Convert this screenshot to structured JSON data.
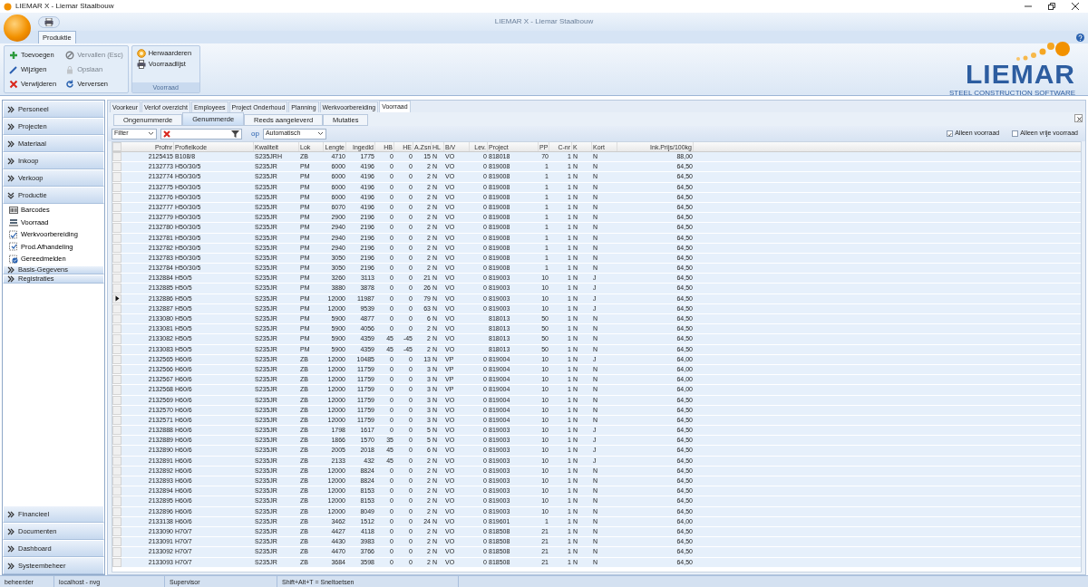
{
  "window": {
    "title": "LIEMAR X - Liemar Staalbouw",
    "caption": "LIEMAR X - Liemar Staalbouw"
  },
  "ribbon": {
    "tabs": [
      {
        "label": "Produktie",
        "selected": true
      }
    ],
    "groups": [
      {
        "buttons": [
          {
            "label": "Toevoegen",
            "disabled": false
          },
          {
            "label": "Wijzigen",
            "disabled": false
          },
          {
            "label": "Verwijderen",
            "disabled": false
          },
          {
            "label": "Vervallen (Esc)",
            "disabled": true
          },
          {
            "label": "Opslaan",
            "disabled": true
          },
          {
            "label": "Verversen",
            "disabled": false
          }
        ]
      },
      {
        "label": "Voorraad",
        "buttons": [
          {
            "label": "Herwaarderen",
            "disabled": false
          },
          {
            "label": "Voorraadlijst",
            "disabled": false
          }
        ]
      }
    ],
    "logo": {
      "name": "LIEMAR",
      "tagline": "STEEL CONSTRUCTION SOFTWARE"
    }
  },
  "sidebar": {
    "top": [
      {
        "label": "Personeel",
        "expanded": false
      },
      {
        "label": "Projecten",
        "expanded": false
      },
      {
        "label": "Materiaal",
        "expanded": false
      },
      {
        "label": "Inkoop",
        "expanded": false
      },
      {
        "label": "Verkoop",
        "expanded": false
      },
      {
        "label": "Productie",
        "expanded": true,
        "children": [
          {
            "label": "Barcodes"
          },
          {
            "label": "Voorraad"
          },
          {
            "label": "Werkvoorbereiding"
          },
          {
            "label": "Prod.Afhandeling"
          },
          {
            "label": "Gereedmelden"
          }
        ]
      }
    ],
    "sub": [
      {
        "label": "Basis-Gegevens"
      },
      {
        "label": "Registraties"
      }
    ],
    "bottom": [
      {
        "label": "Financieel",
        "expanded": false
      },
      {
        "label": "Documenten",
        "expanded": false
      },
      {
        "label": "Dashboard",
        "expanded": false
      },
      {
        "label": "Systeembeheer",
        "expanded": false
      }
    ]
  },
  "tabs": [
    {
      "label": "Voorkeur",
      "selected": false
    },
    {
      "label": "Verlof overzicht",
      "selected": false
    },
    {
      "label": "Employees",
      "selected": false
    },
    {
      "label": "Project Onderhoud",
      "selected": false
    },
    {
      "label": "Planning",
      "selected": false
    },
    {
      "label": "Werkvoorbereiding",
      "selected": false
    },
    {
      "label": "Voorraad",
      "selected": true
    }
  ],
  "subtabs": [
    {
      "label": "Ongenummerde",
      "selected": false
    },
    {
      "label": "Genummerde",
      "selected": true
    },
    {
      "label": "Reeds aangeleverd",
      "selected": false
    },
    {
      "label": "Mutaties",
      "selected": false
    }
  ],
  "filter": {
    "field": "Filter",
    "op_label": "op",
    "mode": "Automatisch",
    "checkboxes": [
      {
        "label": "Alleen voorraad",
        "checked": true
      },
      {
        "label": "Alleen vrije voorraad",
        "checked": false
      }
    ]
  },
  "table": {
    "columns": [
      "Profnr",
      "Profielkode",
      "Kwaliteit",
      "Lok",
      "Lengte",
      "Ingedld",
      "HB",
      "HE",
      "A.Zsn",
      "HL",
      "B/V",
      "Lev.",
      "Project",
      "PP",
      "C-nr",
      "K",
      "Kort",
      "Ink.Prijs/100kg"
    ],
    "rows": [
      {
        "current": false,
        "cells": [
          "2125415",
          "B108/8",
          "S235JRH",
          "ZB",
          "4710",
          "1775",
          "0",
          "0",
          "15",
          "N",
          "VO",
          "0",
          "818018",
          "70",
          "1",
          "N",
          "N",
          "88,00"
        ]
      },
      {
        "current": false,
        "cells": [
          "2132773",
          "H50/30/5",
          "S235JR",
          "PM",
          "6000",
          "4196",
          "0",
          "0",
          "2",
          "N",
          "VO",
          "0",
          "819008",
          "1",
          "1",
          "N",
          "N",
          "64,50"
        ]
      },
      {
        "current": false,
        "cells": [
          "2132774",
          "H50/30/5",
          "S235JR",
          "PM",
          "6000",
          "4196",
          "0",
          "0",
          "2",
          "N",
          "VO",
          "0",
          "819008",
          "1",
          "1",
          "N",
          "N",
          "64,50"
        ]
      },
      {
        "current": false,
        "cells": [
          "2132775",
          "H50/30/5",
          "S235JR",
          "PM",
          "6000",
          "4196",
          "0",
          "0",
          "2",
          "N",
          "VO",
          "0",
          "819008",
          "1",
          "1",
          "N",
          "N",
          "64,50"
        ]
      },
      {
        "current": false,
        "cells": [
          "2132776",
          "H50/30/5",
          "S235JR",
          "PM",
          "6000",
          "4196",
          "0",
          "0",
          "2",
          "N",
          "VO",
          "0",
          "819008",
          "1",
          "1",
          "N",
          "N",
          "64,50"
        ]
      },
      {
        "current": false,
        "cells": [
          "2132777",
          "H50/30/5",
          "S235JR",
          "PM",
          "6070",
          "4196",
          "0",
          "0",
          "2",
          "N",
          "VO",
          "0",
          "819008",
          "1",
          "1",
          "N",
          "N",
          "64,50"
        ]
      },
      {
        "current": false,
        "cells": [
          "2132779",
          "H50/30/5",
          "S235JR",
          "PM",
          "2900",
          "2196",
          "0",
          "0",
          "2",
          "N",
          "VO",
          "0",
          "819008",
          "1",
          "1",
          "N",
          "N",
          "64,50"
        ]
      },
      {
        "current": false,
        "cells": [
          "2132780",
          "H50/30/5",
          "S235JR",
          "PM",
          "2940",
          "2196",
          "0",
          "0",
          "2",
          "N",
          "VO",
          "0",
          "819008",
          "1",
          "1",
          "N",
          "N",
          "64,50"
        ]
      },
      {
        "current": false,
        "cells": [
          "2132781",
          "H50/30/5",
          "S235JR",
          "PM",
          "2940",
          "2196",
          "0",
          "0",
          "2",
          "N",
          "VO",
          "0",
          "819008",
          "1",
          "1",
          "N",
          "N",
          "64,50"
        ]
      },
      {
        "current": false,
        "cells": [
          "2132782",
          "H50/30/5",
          "S235JR",
          "PM",
          "2940",
          "2196",
          "0",
          "0",
          "2",
          "N",
          "VO",
          "0",
          "819008",
          "1",
          "1",
          "N",
          "N",
          "64,50"
        ]
      },
      {
        "current": false,
        "cells": [
          "2132783",
          "H50/30/5",
          "S235JR",
          "PM",
          "3050",
          "2196",
          "0",
          "0",
          "2",
          "N",
          "VO",
          "0",
          "819008",
          "1",
          "1",
          "N",
          "N",
          "64,50"
        ]
      },
      {
        "current": false,
        "cells": [
          "2132784",
          "H50/30/5",
          "S235JR",
          "PM",
          "3050",
          "2196",
          "0",
          "0",
          "2",
          "N",
          "VO",
          "0",
          "819008",
          "1",
          "1",
          "N",
          "N",
          "64,50"
        ]
      },
      {
        "current": false,
        "cells": [
          "2132884",
          "H50/5",
          "S235JR",
          "PM",
          "3260",
          "3113",
          "0",
          "0",
          "21",
          "N",
          "VO",
          "0",
          "819003",
          "10",
          "1",
          "N",
          "J",
          "64,50"
        ]
      },
      {
        "current": false,
        "cells": [
          "2132885",
          "H50/5",
          "S235JR",
          "PM",
          "3880",
          "3878",
          "0",
          "0",
          "26",
          "N",
          "VO",
          "0",
          "819003",
          "10",
          "1",
          "N",
          "J",
          "64,50"
        ]
      },
      {
        "current": true,
        "cells": [
          "2132886",
          "H50/5",
          "S235JR",
          "PM",
          "12000",
          "11987",
          "0",
          "0",
          "79",
          "N",
          "VO",
          "0",
          "819003",
          "10",
          "1",
          "N",
          "J",
          "64,50"
        ]
      },
      {
        "current": false,
        "cells": [
          "2132887",
          "H50/5",
          "S235JR",
          "PM",
          "12000",
          "9539",
          "0",
          "0",
          "63",
          "N",
          "VO",
          "0",
          "819003",
          "10",
          "1",
          "N",
          "J",
          "64,50"
        ]
      },
      {
        "current": false,
        "cells": [
          "2133080",
          "H50/5",
          "S235JR",
          "PM",
          "5900",
          "4877",
          "0",
          "0",
          "6",
          "N",
          "VO",
          null,
          "818013",
          "50",
          "1",
          "N",
          "N",
          "64,50"
        ]
      },
      {
        "current": false,
        "cells": [
          "2133081",
          "H50/5",
          "S235JR",
          "PM",
          "5900",
          "4056",
          "0",
          "0",
          "2",
          "N",
          "VO",
          null,
          "818013",
          "50",
          "1",
          "N",
          "N",
          "64,50"
        ]
      },
      {
        "current": false,
        "cells": [
          "2133082",
          "H50/5",
          "S235JR",
          "PM",
          "5900",
          "4359",
          "45",
          "-45",
          "2",
          "N",
          "VO",
          null,
          "818013",
          "50",
          "1",
          "N",
          "N",
          "64,50"
        ]
      },
      {
        "current": false,
        "cells": [
          "2133083",
          "H50/5",
          "S235JR",
          "PM",
          "5900",
          "4359",
          "45",
          "-45",
          "2",
          "N",
          "VO",
          null,
          "818013",
          "50",
          "1",
          "N",
          "N",
          "64,50"
        ]
      },
      {
        "current": false,
        "cells": [
          "2132565",
          "H60/6",
          "S235JR",
          "ZB",
          "12000",
          "10485",
          "0",
          "0",
          "13",
          "N",
          "VP",
          "0",
          "819004",
          "10",
          "1",
          "N",
          "J",
          "64,00"
        ]
      },
      {
        "current": false,
        "cells": [
          "2132566",
          "H60/6",
          "S235JR",
          "ZB",
          "12000",
          "11759",
          "0",
          "0",
          "3",
          "N",
          "VP",
          "0",
          "819004",
          "10",
          "1",
          "N",
          "N",
          "64,00"
        ]
      },
      {
        "current": false,
        "cells": [
          "2132567",
          "H60/6",
          "S235JR",
          "ZB",
          "12000",
          "11759",
          "0",
          "0",
          "3",
          "N",
          "VP",
          "0",
          "819004",
          "10",
          "1",
          "N",
          "N",
          "64,00"
        ]
      },
      {
        "current": false,
        "cells": [
          "2132568",
          "H60/6",
          "S235JR",
          "ZB",
          "12000",
          "11759",
          "0",
          "0",
          "3",
          "N",
          "VP",
          "0",
          "819004",
          "10",
          "1",
          "N",
          "N",
          "64,00"
        ]
      },
      {
        "current": false,
        "cells": [
          "2132569",
          "H60/6",
          "S235JR",
          "ZB",
          "12000",
          "11759",
          "0",
          "0",
          "3",
          "N",
          "VO",
          "0",
          "819004",
          "10",
          "1",
          "N",
          "N",
          "64,50"
        ]
      },
      {
        "current": false,
        "cells": [
          "2132570",
          "H60/6",
          "S235JR",
          "ZB",
          "12000",
          "11759",
          "0",
          "0",
          "3",
          "N",
          "VO",
          "0",
          "819004",
          "10",
          "1",
          "N",
          "N",
          "64,50"
        ]
      },
      {
        "current": false,
        "cells": [
          "2132571",
          "H60/6",
          "S235JR",
          "ZB",
          "12000",
          "11759",
          "0",
          "0",
          "3",
          "N",
          "VO",
          "0",
          "819004",
          "10",
          "1",
          "N",
          "N",
          "64,50"
        ]
      },
      {
        "current": false,
        "cells": [
          "2132888",
          "H60/6",
          "S235JR",
          "ZB",
          "1798",
          "1617",
          "0",
          "0",
          "5",
          "N",
          "VO",
          "0",
          "819003",
          "10",
          "1",
          "N",
          "J",
          "64,50"
        ]
      },
      {
        "current": false,
        "cells": [
          "2132889",
          "H60/6",
          "S235JR",
          "ZB",
          "1866",
          "1570",
          "35",
          "0",
          "5",
          "N",
          "VO",
          "0",
          "819003",
          "10",
          "1",
          "N",
          "J",
          "64,50"
        ]
      },
      {
        "current": false,
        "cells": [
          "2132890",
          "H60/6",
          "S235JR",
          "ZB",
          "2005",
          "2018",
          "45",
          "0",
          "6",
          "N",
          "VO",
          "0",
          "819003",
          "10",
          "1",
          "N",
          "J",
          "64,50"
        ]
      },
      {
        "current": false,
        "cells": [
          "2132891",
          "H60/6",
          "S235JR",
          "ZB",
          "2133",
          "432",
          "45",
          "0",
          "2",
          "N",
          "VO",
          "0",
          "819003",
          "10",
          "1",
          "N",
          "J",
          "64,50"
        ]
      },
      {
        "current": false,
        "cells": [
          "2132892",
          "H60/6",
          "S235JR",
          "ZB",
          "12000",
          "8824",
          "0",
          "0",
          "2",
          "N",
          "VO",
          "0",
          "819003",
          "10",
          "1",
          "N",
          "N",
          "64,50"
        ]
      },
      {
        "current": false,
        "cells": [
          "2132893",
          "H60/6",
          "S235JR",
          "ZB",
          "12000",
          "8824",
          "0",
          "0",
          "2",
          "N",
          "VO",
          "0",
          "819003",
          "10",
          "1",
          "N",
          "N",
          "64,50"
        ]
      },
      {
        "current": false,
        "cells": [
          "2132894",
          "H60/6",
          "S235JR",
          "ZB",
          "12000",
          "8153",
          "0",
          "0",
          "2",
          "N",
          "VO",
          "0",
          "819003",
          "10",
          "1",
          "N",
          "N",
          "64,50"
        ]
      },
      {
        "current": false,
        "cells": [
          "2132895",
          "H60/6",
          "S235JR",
          "ZB",
          "12000",
          "8153",
          "0",
          "0",
          "2",
          "N",
          "VO",
          "0",
          "819003",
          "10",
          "1",
          "N",
          "N",
          "64,50"
        ]
      },
      {
        "current": false,
        "cells": [
          "2132896",
          "H60/6",
          "S235JR",
          "ZB",
          "12000",
          "8049",
          "0",
          "0",
          "2",
          "N",
          "VO",
          "0",
          "819003",
          "10",
          "1",
          "N",
          "N",
          "64,50"
        ]
      },
      {
        "current": false,
        "cells": [
          "2133138",
          "H60/6",
          "S235JR",
          "ZB",
          "3462",
          "1512",
          "0",
          "0",
          "24",
          "N",
          "VO",
          "0",
          "819601",
          "1",
          "1",
          "N",
          "N",
          "64,00"
        ]
      },
      {
        "current": false,
        "cells": [
          "2133090",
          "H70/7",
          "S235JR",
          "ZB",
          "4427",
          "4118",
          "0",
          "0",
          "2",
          "N",
          "VO",
          "0",
          "818508",
          "21",
          "1",
          "N",
          "N",
          "64,50"
        ]
      },
      {
        "current": false,
        "cells": [
          "2133091",
          "H70/7",
          "S235JR",
          "ZB",
          "4430",
          "3983",
          "0",
          "0",
          "2",
          "N",
          "VO",
          "0",
          "818508",
          "21",
          "1",
          "N",
          "N",
          "64,50"
        ]
      },
      {
        "current": false,
        "cells": [
          "2133092",
          "H70/7",
          "S235JR",
          "ZB",
          "4470",
          "3766",
          "0",
          "0",
          "2",
          "N",
          "VO",
          "0",
          "818508",
          "21",
          "1",
          "N",
          "N",
          "64,50"
        ]
      },
      {
        "current": false,
        "cells": [
          "2133093",
          "H70/7",
          "S235JR",
          "ZB",
          "3684",
          "3598",
          "0",
          "0",
          "2",
          "N",
          "VO",
          "0",
          "818508",
          "21",
          "1",
          "N",
          "N",
          "64,50"
        ]
      }
    ]
  },
  "status_bar": [
    "beheerder",
    "localhost - nvg",
    "Supervisor",
    "Shift+Alt+T = Sneltoetsen"
  ]
}
